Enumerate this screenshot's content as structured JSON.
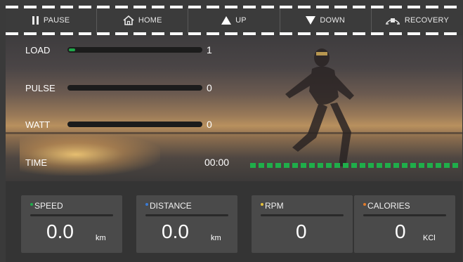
{
  "toolbar": {
    "pause_label": "PAUSE",
    "home_label": "HOME",
    "up_label": "UP",
    "down_label": "DOWN",
    "recovery_label": "RECOVERY"
  },
  "metrics": {
    "load": {
      "label": "LOAD",
      "value": "1",
      "level_fraction": 0.05
    },
    "pulse": {
      "label": "PULSE",
      "value": "0"
    },
    "watt": {
      "label": "WATT",
      "value": "0"
    },
    "time": {
      "label": "TIME",
      "value": "00:00"
    }
  },
  "tiles": [
    {
      "label": "SPEED",
      "value": "0.0",
      "unit": "km",
      "dot_color": "#1fae4a"
    },
    {
      "label": "DISTANCE",
      "value": "0.0",
      "unit": "km",
      "dot_color": "#3a7bd5"
    },
    {
      "label": "RPM",
      "value": "0",
      "unit": "",
      "dot_color": "#e6c13a"
    },
    {
      "label": "CALORIES",
      "value": "0",
      "unit": "KCl",
      "dot_color": "#e07a2a"
    }
  ],
  "colors": {
    "accent_green": "#1fae4a",
    "panel_bg": "#3a3a3a",
    "tile_bg": "#4a4a4a"
  },
  "icons": {
    "pause": "pause-icon",
    "home": "home-icon",
    "up": "triangle-up-icon",
    "down": "triangle-down-icon",
    "recovery": "recovery-icon"
  }
}
